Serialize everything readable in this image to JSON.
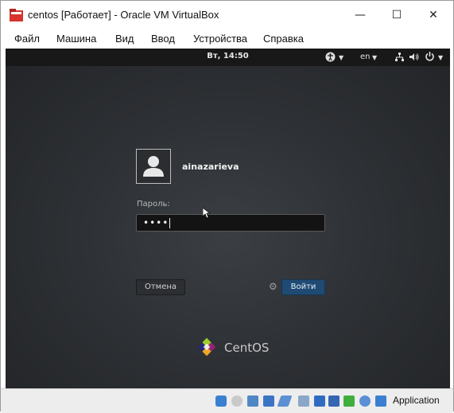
{
  "window": {
    "title": "centos [Работает] - Oracle VM VirtualBox",
    "minimize_glyph": "—",
    "maximize_glyph": "☐",
    "close_glyph": "✕"
  },
  "menu": {
    "items": [
      "Файл",
      "Машина",
      "Вид",
      "Ввод",
      "Устройства",
      "Справка"
    ]
  },
  "gnome_topbar": {
    "clock": "Вт, 14:50",
    "language": "en",
    "icons": [
      "accessibility-icon",
      "network-icon",
      "volume-icon",
      "power-icon"
    ]
  },
  "login": {
    "username": "ainazarieva",
    "password_label": "Пароль:",
    "password_value": "••••",
    "cancel_label": "Отмена",
    "login_label": "Войти"
  },
  "branding": {
    "logo_text": "CentOS"
  },
  "statusbar": {
    "text": "Application",
    "icons": [
      "hdd-icon",
      "optical-icon",
      "audio-icon",
      "network-icon",
      "usb-icon",
      "shared-folder-icon",
      "display-icon",
      "recording-icon",
      "cpu-icon",
      "mouse-integration-icon",
      "keyboard-icon"
    ]
  },
  "colors": {
    "vm_background": "#2e3135",
    "login_button": "#1f4a73",
    "topbar": "#181818"
  }
}
